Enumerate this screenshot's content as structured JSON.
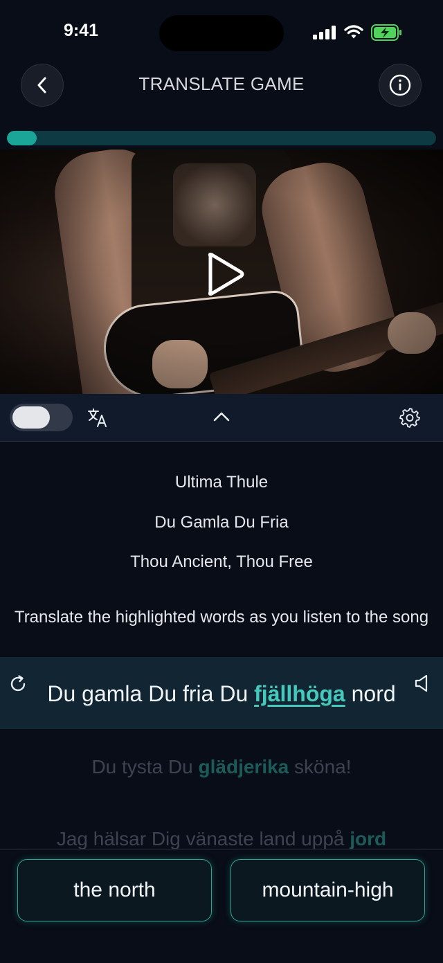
{
  "status_bar": {
    "time": "9:41"
  },
  "header": {
    "title": "TRANSLATE GAME"
  },
  "progress": {
    "value": 0.07,
    "color": "#1aa598"
  },
  "song": {
    "title": "Ultima Thule",
    "subtitle": "Du Gamla Du Fria",
    "translation": "Thou Ancient, Thou Free"
  },
  "instruction": "Translate the highlighted words as you listen to the song",
  "lyrics": {
    "active": {
      "before": "Du gamla Du fria Du ",
      "highlight": "fjällhöga",
      "after": " nord"
    },
    "next": {
      "before": "Du tysta Du ",
      "highlight": "glädjerika",
      "after": " sköna!"
    },
    "third": {
      "before": "Jag hälsar Dig vänaste land uppå ",
      "highlight": "jord",
      "after": ""
    }
  },
  "options": [
    "the north",
    "mountain-high"
  ],
  "colors": {
    "accent": "#46c9bd",
    "background": "#080d17"
  },
  "icons": [
    "back-icon",
    "info-icon",
    "play-icon",
    "translate-icon",
    "chevron-up-icon",
    "gear-icon",
    "replay-icon",
    "volume-icon"
  ]
}
